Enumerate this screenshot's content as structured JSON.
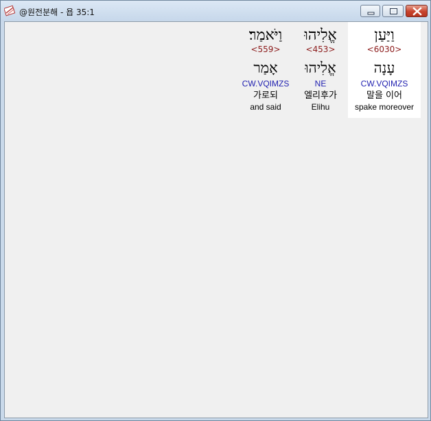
{
  "window": {
    "title": "@원전분해 - 욥 35:1"
  },
  "words": [
    {
      "hebrew": "וַיַּעַן",
      "strongs": "<6030>",
      "lemma": "עָנָה",
      "morph": "CW.VQIMZS",
      "korean": "말을 이어",
      "english": "spake moreover"
    },
    {
      "hebrew": "אֱלִיהוּ",
      "strongs": "<453>",
      "lemma": "אֱלִיהוּ",
      "morph": "NE",
      "korean": "엘리후가",
      "english": "Elihu"
    },
    {
      "hebrew": "וַיֹּאמַר׃",
      "strongs": "<559>",
      "lemma": "אָמַר",
      "morph": "CW.VQIMZS",
      "korean": "가로되",
      "english": "and said"
    }
  ],
  "colors": {
    "strongs": "#8b1a1a",
    "morph": "#2020b0",
    "selected_background": "#ffffff"
  },
  "icons": {
    "app": "app-icon",
    "minimize": "minimize-icon",
    "maximize": "maximize-icon",
    "close": "close-icon"
  }
}
